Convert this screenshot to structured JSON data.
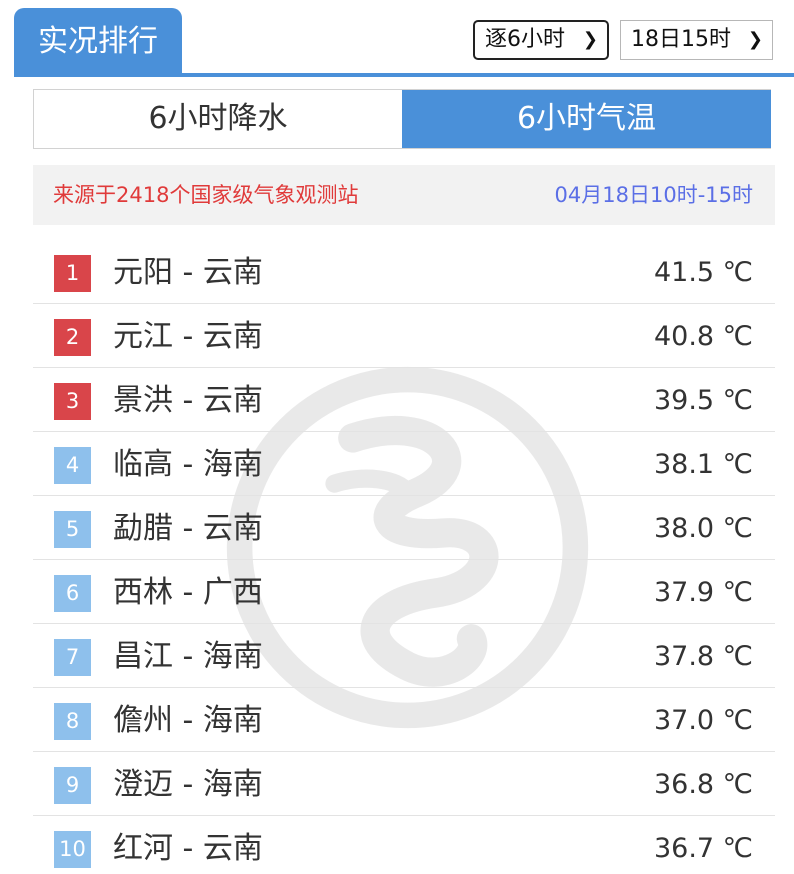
{
  "header": {
    "title": "实况排行",
    "interval_select": "逐6小时",
    "time_select": "18日15时"
  },
  "tabs": [
    {
      "label": "6小时降水",
      "active": false
    },
    {
      "label": "6小时气温",
      "active": true
    }
  ],
  "source": {
    "text": "来源于2418个国家级气象观测站",
    "period": "04月18日10时-15时"
  },
  "ranking": [
    {
      "rank": "1",
      "station": "元阳 - 云南",
      "value": "41.5 ℃"
    },
    {
      "rank": "2",
      "station": "元江 - 云南",
      "value": "40.8 ℃"
    },
    {
      "rank": "3",
      "station": "景洪 - 云南",
      "value": "39.5 ℃"
    },
    {
      "rank": "4",
      "station": "临高 - 海南",
      "value": "38.1 ℃"
    },
    {
      "rank": "5",
      "station": "勐腊 - 云南",
      "value": "38.0 ℃"
    },
    {
      "rank": "6",
      "station": "西林 - 广西",
      "value": "37.9 ℃"
    },
    {
      "rank": "7",
      "station": "昌江 - 海南",
      "value": "37.8 ℃"
    },
    {
      "rank": "8",
      "station": "儋州 - 海南",
      "value": "37.0 ℃"
    },
    {
      "rank": "9",
      "station": "澄迈 - 海南",
      "value": "36.8 ℃"
    },
    {
      "rank": "10",
      "station": "红河 - 云南",
      "value": "36.7 ℃"
    }
  ],
  "colors": {
    "accent_blue": "#4a90d9",
    "badge_top": "#d9454a",
    "badge_other": "#8ec0ec",
    "source_red": "#e03a3a",
    "period_blue": "#5b6fe6",
    "watermark": "#8a8a8a"
  },
  "icons": {
    "dropdown": "chevron-down-icon",
    "watermark": "logo-watermark"
  }
}
